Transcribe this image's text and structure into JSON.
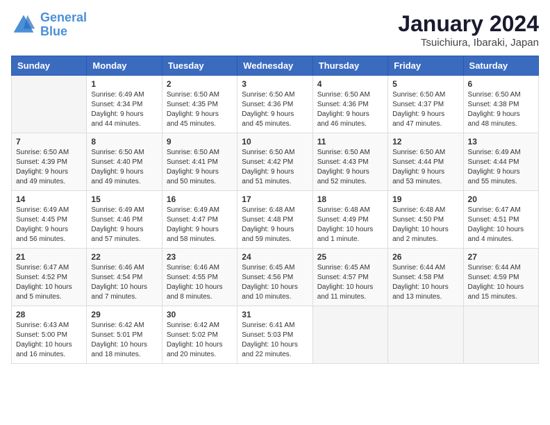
{
  "header": {
    "logo_line1": "General",
    "logo_line2": "Blue",
    "title": "January 2024",
    "subtitle": "Tsuichiura, Ibaraki, Japan"
  },
  "days_of_week": [
    "Sunday",
    "Monday",
    "Tuesday",
    "Wednesday",
    "Thursday",
    "Friday",
    "Saturday"
  ],
  "weeks": [
    [
      {
        "day": "",
        "info": ""
      },
      {
        "day": "1",
        "info": "Sunrise: 6:49 AM\nSunset: 4:34 PM\nDaylight: 9 hours\nand 44 minutes."
      },
      {
        "day": "2",
        "info": "Sunrise: 6:50 AM\nSunset: 4:35 PM\nDaylight: 9 hours\nand 45 minutes."
      },
      {
        "day": "3",
        "info": "Sunrise: 6:50 AM\nSunset: 4:36 PM\nDaylight: 9 hours\nand 45 minutes."
      },
      {
        "day": "4",
        "info": "Sunrise: 6:50 AM\nSunset: 4:36 PM\nDaylight: 9 hours\nand 46 minutes."
      },
      {
        "day": "5",
        "info": "Sunrise: 6:50 AM\nSunset: 4:37 PM\nDaylight: 9 hours\nand 47 minutes."
      },
      {
        "day": "6",
        "info": "Sunrise: 6:50 AM\nSunset: 4:38 PM\nDaylight: 9 hours\nand 48 minutes."
      }
    ],
    [
      {
        "day": "7",
        "info": "Sunrise: 6:50 AM\nSunset: 4:39 PM\nDaylight: 9 hours\nand 49 minutes."
      },
      {
        "day": "8",
        "info": "Sunrise: 6:50 AM\nSunset: 4:40 PM\nDaylight: 9 hours\nand 49 minutes."
      },
      {
        "day": "9",
        "info": "Sunrise: 6:50 AM\nSunset: 4:41 PM\nDaylight: 9 hours\nand 50 minutes."
      },
      {
        "day": "10",
        "info": "Sunrise: 6:50 AM\nSunset: 4:42 PM\nDaylight: 9 hours\nand 51 minutes."
      },
      {
        "day": "11",
        "info": "Sunrise: 6:50 AM\nSunset: 4:43 PM\nDaylight: 9 hours\nand 52 minutes."
      },
      {
        "day": "12",
        "info": "Sunrise: 6:50 AM\nSunset: 4:44 PM\nDaylight: 9 hours\nand 53 minutes."
      },
      {
        "day": "13",
        "info": "Sunrise: 6:49 AM\nSunset: 4:44 PM\nDaylight: 9 hours\nand 55 minutes."
      }
    ],
    [
      {
        "day": "14",
        "info": "Sunrise: 6:49 AM\nSunset: 4:45 PM\nDaylight: 9 hours\nand 56 minutes."
      },
      {
        "day": "15",
        "info": "Sunrise: 6:49 AM\nSunset: 4:46 PM\nDaylight: 9 hours\nand 57 minutes."
      },
      {
        "day": "16",
        "info": "Sunrise: 6:49 AM\nSunset: 4:47 PM\nDaylight: 9 hours\nand 58 minutes."
      },
      {
        "day": "17",
        "info": "Sunrise: 6:48 AM\nSunset: 4:48 PM\nDaylight: 9 hours\nand 59 minutes."
      },
      {
        "day": "18",
        "info": "Sunrise: 6:48 AM\nSunset: 4:49 PM\nDaylight: 10 hours\nand 1 minute."
      },
      {
        "day": "19",
        "info": "Sunrise: 6:48 AM\nSunset: 4:50 PM\nDaylight: 10 hours\nand 2 minutes."
      },
      {
        "day": "20",
        "info": "Sunrise: 6:47 AM\nSunset: 4:51 PM\nDaylight: 10 hours\nand 4 minutes."
      }
    ],
    [
      {
        "day": "21",
        "info": "Sunrise: 6:47 AM\nSunset: 4:52 PM\nDaylight: 10 hours\nand 5 minutes."
      },
      {
        "day": "22",
        "info": "Sunrise: 6:46 AM\nSunset: 4:54 PM\nDaylight: 10 hours\nand 7 minutes."
      },
      {
        "day": "23",
        "info": "Sunrise: 6:46 AM\nSunset: 4:55 PM\nDaylight: 10 hours\nand 8 minutes."
      },
      {
        "day": "24",
        "info": "Sunrise: 6:45 AM\nSunset: 4:56 PM\nDaylight: 10 hours\nand 10 minutes."
      },
      {
        "day": "25",
        "info": "Sunrise: 6:45 AM\nSunset: 4:57 PM\nDaylight: 10 hours\nand 11 minutes."
      },
      {
        "day": "26",
        "info": "Sunrise: 6:44 AM\nSunset: 4:58 PM\nDaylight: 10 hours\nand 13 minutes."
      },
      {
        "day": "27",
        "info": "Sunrise: 6:44 AM\nSunset: 4:59 PM\nDaylight: 10 hours\nand 15 minutes."
      }
    ],
    [
      {
        "day": "28",
        "info": "Sunrise: 6:43 AM\nSunset: 5:00 PM\nDaylight: 10 hours\nand 16 minutes."
      },
      {
        "day": "29",
        "info": "Sunrise: 6:42 AM\nSunset: 5:01 PM\nDaylight: 10 hours\nand 18 minutes."
      },
      {
        "day": "30",
        "info": "Sunrise: 6:42 AM\nSunset: 5:02 PM\nDaylight: 10 hours\nand 20 minutes."
      },
      {
        "day": "31",
        "info": "Sunrise: 6:41 AM\nSunset: 5:03 PM\nDaylight: 10 hours\nand 22 minutes."
      },
      {
        "day": "",
        "info": ""
      },
      {
        "day": "",
        "info": ""
      },
      {
        "day": "",
        "info": ""
      }
    ]
  ]
}
